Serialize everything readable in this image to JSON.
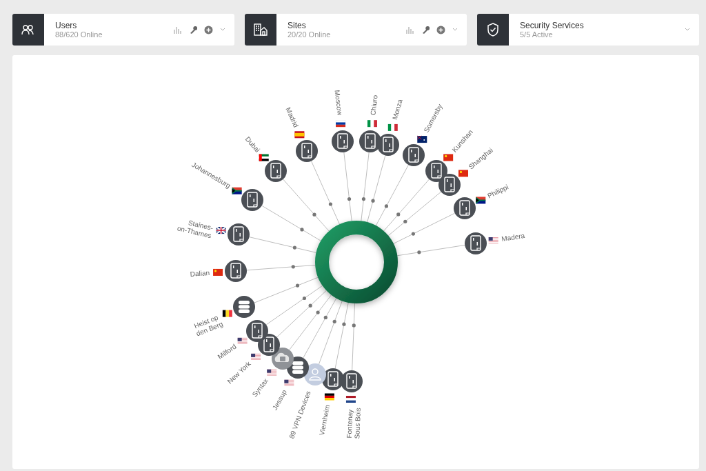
{
  "cards": [
    {
      "kind": "users",
      "title": "Users",
      "subtitle": "88/620 Online",
      "actions": true
    },
    {
      "kind": "sites",
      "title": "Sites",
      "subtitle": "20/20 Online",
      "actions": true
    },
    {
      "kind": "security",
      "title": "Security Services",
      "subtitle": "5/5 Active",
      "actions": false
    }
  ],
  "diagram": {
    "nodes": [
      {
        "label": "Dalian",
        "kind": "device",
        "flag": {
          "kind": "cn"
        }
      },
      {
        "label": "Staines-on-Thames",
        "kind": "device",
        "flag": {
          "kind": "gb"
        }
      },
      {
        "label": "Johannesburg",
        "kind": "device",
        "flag": {
          "kind": "za"
        }
      },
      {
        "label": "Dubai",
        "kind": "device",
        "flag": {
          "kind": "ae"
        }
      },
      {
        "label": "Madrid",
        "kind": "device",
        "flag": {
          "kind": "es"
        }
      },
      {
        "label": "Moscow",
        "kind": "device",
        "flag": {
          "kind": "ru"
        }
      },
      {
        "label": "Chiuro",
        "kind": "device",
        "flag": {
          "kind": "it"
        }
      },
      {
        "label": "Monza",
        "kind": "device",
        "flag": {
          "kind": "it"
        }
      },
      {
        "label": "Somersby",
        "kind": "device",
        "flag": {
          "kind": "au"
        }
      },
      {
        "label": "Kunshan",
        "kind": "device",
        "flag": {
          "kind": "cn"
        }
      },
      {
        "label": "Shanghai",
        "kind": "device",
        "flag": {
          "kind": "cn"
        }
      },
      {
        "label": "Philippi",
        "kind": "device",
        "flag": {
          "kind": "za"
        }
      },
      {
        "label": "Madera",
        "kind": "device",
        "flag": {
          "kind": "us"
        }
      },
      {
        "label": "Fontenay Sous Bois",
        "kind": "device",
        "flag": {
          "kind": "nl"
        }
      },
      {
        "label": "Viernheim",
        "kind": "device",
        "flag": {
          "kind": "de"
        }
      },
      {
        "label": "89 VPN Devices",
        "kind": "user"
      },
      {
        "label": "Jessup",
        "kind": "database",
        "flag": {
          "kind": "us"
        }
      },
      {
        "label": "Syntax",
        "kind": "cloud",
        "flag": {
          "kind": "us"
        }
      },
      {
        "label": "New York",
        "kind": "device",
        "flag": {
          "kind": "us"
        }
      },
      {
        "label": "Milford",
        "kind": "device",
        "flag": {
          "kind": "us"
        }
      },
      {
        "label": "Heist op den Berg",
        "kind": "database",
        "flag": {
          "kind": "be"
        }
      }
    ]
  }
}
